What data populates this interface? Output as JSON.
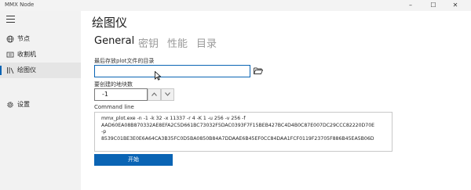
{
  "window": {
    "app_title": "MMX Node",
    "controls": {
      "minimize": "–",
      "maximize": "☐",
      "close": "✕"
    }
  },
  "sidebar": {
    "items": [
      {
        "label": "节点",
        "icon": "globe-icon",
        "active": false
      },
      {
        "label": "收割机",
        "icon": "harvester-icon",
        "active": false
      },
      {
        "label": "绘图仪",
        "icon": "plotter-icon",
        "active": true
      },
      {
        "label": "设置",
        "icon": "gear-icon",
        "active": false
      }
    ]
  },
  "main": {
    "title": "绘图仪",
    "tabs": [
      {
        "label": "General",
        "active": true
      },
      {
        "label": "密钥",
        "active": false
      },
      {
        "label": "性能",
        "active": false
      },
      {
        "label": "目录",
        "active": false
      }
    ],
    "plot_dir_label": "最后存放plot文件的目录",
    "plot_dir_value": "",
    "plot_count_label": "要创建的地块数",
    "plot_count_value": "-1",
    "command_line_label": "Command line",
    "command_lines": [
      "mmx_plot.exe  -n -1 -k 32 -x 11337 -r 4 -K 1 -u 256 -v 256 -f",
      "AAD60EA08B870332AE8EFA2C5D661BC73032F5DAC0393F7F15BEB427BC4D4B0C87E007DC29CCC82220D70E",
      "-p",
      "8539C01BE3E0E6A64CA3B35FC0D5BA0850B84A7DDAAE6B45EF0CC84DAA1FCF0119F23705F886B45EA5B06D"
    ],
    "start_button": "开始"
  },
  "colors": {
    "accent": "#0a64b4",
    "sidebar_bg": "#f2f2f2"
  }
}
